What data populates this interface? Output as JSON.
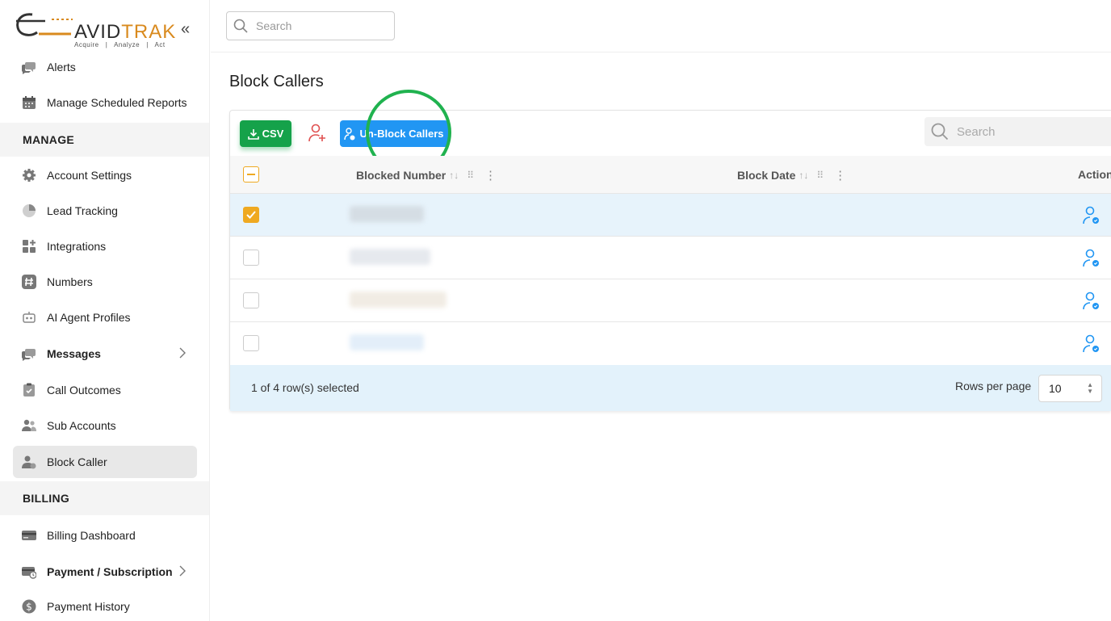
{
  "brand": {
    "name_main": "AVID",
    "name_accent": "TRAK",
    "tagline": "Acquire   |   Analyze   |   Act",
    "accent_color": "#d98a1e"
  },
  "sidebar": {
    "collapse_label": "«",
    "items_top": [
      {
        "label": "Alerts",
        "icon": "chat-bubble-icon"
      },
      {
        "label": "Manage Scheduled Reports",
        "icon": "calendar-icon"
      }
    ],
    "section_manage": "MANAGE",
    "items_manage": [
      {
        "label": "Account Settings",
        "icon": "gear-icon"
      },
      {
        "label": "Lead Tracking",
        "icon": "pie-chart-icon"
      },
      {
        "label": "Integrations",
        "icon": "grid-plus-icon"
      },
      {
        "label": "Numbers",
        "icon": "hash-icon"
      },
      {
        "label": "AI Agent Profiles",
        "icon": "robot-icon"
      },
      {
        "label": "Messages",
        "icon": "chat-bubble-icon"
      },
      {
        "label": "Call Outcomes",
        "icon": "clipboard-check-icon"
      },
      {
        "label": "Sub Accounts",
        "icon": "users-icon"
      },
      {
        "label": "Block Caller",
        "icon": "user-block-icon"
      }
    ],
    "section_billing": "BILLING",
    "items_billing": [
      {
        "label": "Billing Dashboard",
        "icon": "card-icon"
      },
      {
        "label": "Payment / Subscription",
        "icon": "card-clock-icon"
      },
      {
        "label": "Payment History",
        "icon": "dollar-circle-icon"
      }
    ]
  },
  "topbar": {
    "search_placeholder": "Search"
  },
  "page": {
    "title": "Block Callers"
  },
  "toolbar": {
    "csv_label": "CSV",
    "unblock_label": "Un-Block Callers",
    "search_placeholder": "Search"
  },
  "table": {
    "columns": [
      "Blocked Number",
      "Block Date",
      "Action"
    ],
    "rows": [
      {
        "selected": true
      },
      {
        "selected": false
      },
      {
        "selected": false
      },
      {
        "selected": false
      }
    ],
    "selection_text": "1 of 4 row(s) selected",
    "rows_per_page_label": "Rows per page",
    "rows_per_page_value": "10"
  },
  "colors": {
    "csv_green": "#15a24a",
    "unblock_blue": "#2196f3",
    "checkbox_orange": "#efa921",
    "highlight_ring": "#20b24f"
  }
}
